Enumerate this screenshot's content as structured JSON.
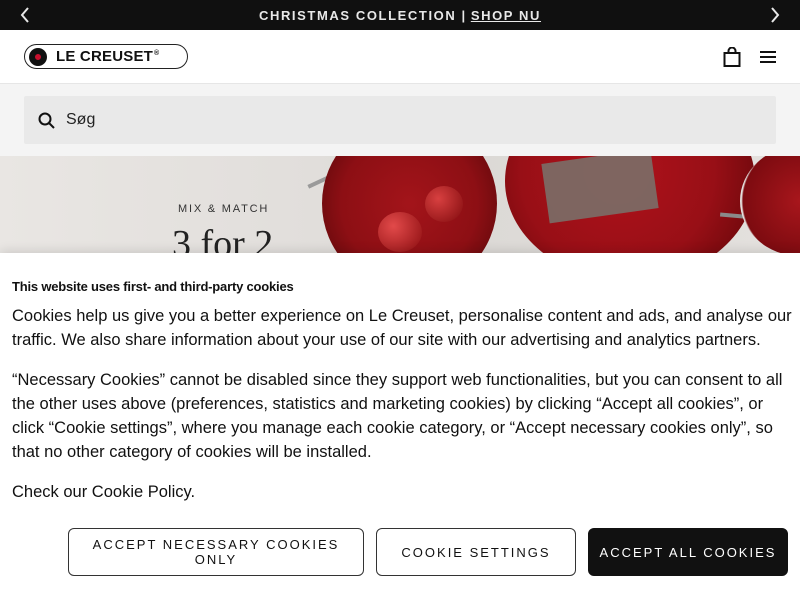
{
  "announcement": {
    "text": "CHRISTMAS COLLECTION |",
    "link": "SHOP NU",
    "prev_icon": "chevron-left-icon",
    "next_icon": "chevron-right-icon"
  },
  "header": {
    "logo_text": "LE CREUSET",
    "logo_reg": "®",
    "icons": [
      "shopping-bag-icon",
      "hamburger-menu-icon"
    ]
  },
  "search": {
    "placeholder": "Søg",
    "icon": "search-icon"
  },
  "hero": {
    "eyebrow": "MIX & MATCH",
    "headline": "3 for 2"
  },
  "cookie_banner": {
    "title": "This website uses first- and third-party cookies",
    "paragraph_1": "Cookies help us give you a better experience on Le Creuset, personalise content and ads, and analyse our traffic. We also share information about your use of our site with our advertising and analytics partners.",
    "paragraph_2": "“Necessary Cookies” cannot be disabled since they support web functionalities, but you can consent to all the other uses above (preferences, statistics and marketing cookies) by clicking “Accept all cookies”, or click “Cookie settings”, where you manage each cookie category, or “Accept necessary cookies only”, so that no other category of cookies will be installed.",
    "policy_prefix": "Check our",
    "policy_link": "Cookie Policy",
    "policy_suffix": ".",
    "buttons": {
      "necessary": "ACCEPT NECESSARY COOKIES ONLY",
      "settings": "COOKIE SETTINGS",
      "accept_all": "ACCEPT ALL COOKIES"
    }
  }
}
